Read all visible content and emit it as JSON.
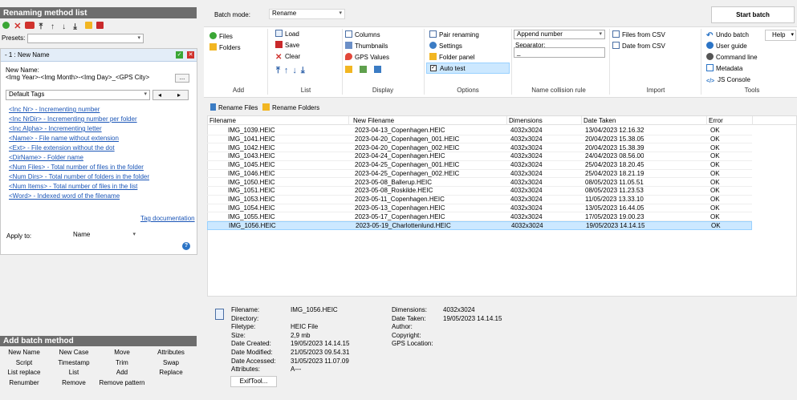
{
  "left": {
    "header": "Renaming method list",
    "presets_label": "Presets:",
    "method_title": "- 1 : New Name",
    "new_name_label": "New Name:",
    "new_name_value": "<Img Year>-<Img Month>-<Img Day>_<GPS City>",
    "ellipsis": "...",
    "tags_select": "Default Tags",
    "nav_prev": "◂",
    "nav_next": "▸",
    "tags": [
      "<Inc Nr> - Incrementing number",
      "<Inc NrDir> - Incrementing number per folder",
      "<Inc Alpha> - Incrementing letter",
      "<Name> - File name without extension",
      "<Ext> - File extension without the dot",
      "<DirName> - Folder name",
      "<Num Files> - Total number of files in the folder",
      "<Num Dirs> - Total number of folders in the folder",
      "<Num Items> - Total number of files in the list",
      "<Word> - Indexed word of the filename"
    ],
    "tag_doc": "Tag documentation",
    "apply_label": "Apply to:",
    "apply_value": "Name",
    "help_glyph": "?",
    "batch_header": "Add batch method",
    "batch_methods": [
      [
        "New Name",
        "New Case",
        "Move",
        "Attributes"
      ],
      [
        "Script",
        "Timestamp",
        "Trim",
        "Swap"
      ],
      [
        "List replace",
        "List",
        "Add",
        "Replace"
      ],
      [
        "Renumber",
        "Remove",
        "Remove pattern",
        ""
      ]
    ]
  },
  "top": {
    "batch_mode_label": "Batch mode:",
    "batch_mode_value": "Rename",
    "start_batch": "Start batch",
    "help": "Help"
  },
  "ribbon": {
    "add": {
      "files": "Files",
      "folders": "Folders",
      "label": "Add"
    },
    "list": {
      "load": "Load",
      "save": "Save",
      "clear": "Clear",
      "label": "List"
    },
    "display": {
      "columns": "Columns",
      "thumbnails": "Thumbnails",
      "gps": "GPS Values",
      "label": "Display"
    },
    "options": {
      "pair": "Pair renaming",
      "settings": "Settings",
      "folder_panel": "Folder panel",
      "auto_test": "Auto test",
      "label": "Options"
    },
    "collision": {
      "value": "Append number",
      "separator_label": "Separator:",
      "separator_value": "_",
      "label": "Name collision rule"
    },
    "import": {
      "files_csv": "Files from CSV",
      "date_csv": "Date from CSV",
      "label": "Import"
    },
    "tools": {
      "undo": "Undo batch",
      "guide": "User guide",
      "cmd": "Command line",
      "metadata": "Metadata",
      "js": "JS Console",
      "label": "Tools"
    }
  },
  "tabs": {
    "files": "Rename Files",
    "folders": "Rename Folders"
  },
  "grid": {
    "columns": [
      "Filename",
      "New Filename",
      "Dimensions",
      "Date Taken",
      "Error"
    ],
    "rows": [
      [
        "IMG_1039.HEIC",
        "2023-04-13_Copenhagen.HEIC",
        "4032x3024",
        "13/04/2023 12.16.32",
        "OK"
      ],
      [
        "IMG_1041.HEIC",
        "2023-04-20_Copenhagen_001.HEIC",
        "4032x3024",
        "20/04/2023 15.38.05",
        "OK"
      ],
      [
        "IMG_1042.HEIC",
        "2023-04-20_Copenhagen_002.HEIC",
        "4032x3024",
        "20/04/2023 15.38.39",
        "OK"
      ],
      [
        "IMG_1043.HEIC",
        "2023-04-24_Copenhagen.HEIC",
        "4032x3024",
        "24/04/2023 08.56.00",
        "OK"
      ],
      [
        "IMG_1045.HEIC",
        "2023-04-25_Copenhagen_001.HEIC",
        "4032x3024",
        "25/04/2023 18.20.45",
        "OK"
      ],
      [
        "IMG_1046.HEIC",
        "2023-04-25_Copenhagen_002.HEIC",
        "4032x3024",
        "25/04/2023 18.21.19",
        "OK"
      ],
      [
        "IMG_1050.HEIC",
        "2023-05-08_Ballerup.HEIC",
        "4032x3024",
        "08/05/2023 11.05.51",
        "OK"
      ],
      [
        "IMG_1051.HEIC",
        "2023-05-08_Roskilde.HEIC",
        "4032x3024",
        "08/05/2023 11.23.53",
        "OK"
      ],
      [
        "IMG_1053.HEIC",
        "2023-05-11_Copenhagen.HEIC",
        "4032x3024",
        "11/05/2023 13.33.10",
        "OK"
      ],
      [
        "IMG_1054.HEIC",
        "2023-05-13_Copenhagen.HEIC",
        "4032x3024",
        "13/05/2023 16.44.05",
        "OK"
      ],
      [
        "IMG_1055.HEIC",
        "2023-05-17_Copenhagen.HEIC",
        "4032x3024",
        "17/05/2023 19.00.23",
        "OK"
      ],
      [
        "IMG_1056.HEIC",
        "2023-05-19_Charlottenlund.HEIC",
        "4032x3024",
        "19/05/2023 14.14.15",
        "OK"
      ]
    ]
  },
  "info": {
    "labels": [
      "Filename:",
      "Directory:",
      "Filetype:",
      "Size:",
      "Date Created:",
      "Date Modified:",
      "Date Accessed:",
      "Attributes:"
    ],
    "values": [
      "IMG_1056.HEIC",
      "",
      "HEIC File",
      "2,9 mb",
      "19/05/2023 14.14.15",
      "21/05/2023 09.54.31",
      "31/05/2023 11.07.09",
      "A---"
    ],
    "labels2": [
      "Dimensions:",
      "Date Taken:",
      "Author:",
      "Copyright:",
      "GPS Location:"
    ],
    "values2": [
      "4032x3024",
      "19/05/2023 14.14.15",
      "",
      "",
      ""
    ],
    "exiftool": "ExifTool..."
  },
  "colors": {
    "header": "#6d6d6d",
    "link": "#1a55b7",
    "selected": "#cce8ff",
    "accent": "#2b74c6"
  }
}
